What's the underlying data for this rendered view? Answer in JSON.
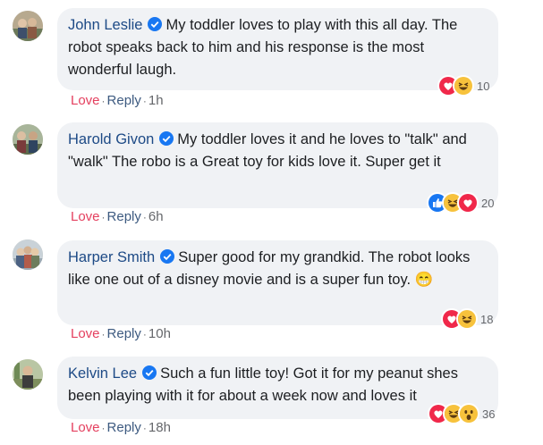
{
  "comments": [
    {
      "name": "John Leslie",
      "text": "My toddler loves to play with this all day. The robot speaks back to him and his response is the most wonderful laugh.",
      "reaction_count": "10",
      "love_label": "Love",
      "reply_label": "Reply",
      "time": "1h",
      "reactions": [
        "love-icon",
        "laugh-icon"
      ]
    },
    {
      "name": "Harold Givon",
      "text": "My toddler loves it and he loves to \"talk\" and \"walk\" The robo is a Great toy for kids love it. Super get it",
      "reaction_count": "20",
      "love_label": "Love",
      "reply_label": "Reply",
      "time": "6h",
      "reactions": [
        "like-icon",
        "laugh-icon",
        "love-icon"
      ]
    },
    {
      "name": "Harper Smith",
      "text": "Super good for my grandkid. The robot looks like one out of a disney movie and is a super fun toy. 😁",
      "reaction_count": "18",
      "love_label": "Love",
      "reply_label": "Reply",
      "time": "10h",
      "reactions": [
        "love-icon",
        "laugh-icon"
      ]
    },
    {
      "name": "Kelvin Lee",
      "text": "Such a fun little toy! Got it for my peanut shes been playing with it for about a week now and loves it",
      "reaction_count": "36",
      "love_label": "Love",
      "reply_label": "Reply",
      "time": "18h",
      "reactions": [
        "love-icon",
        "laugh-icon",
        "wow-icon"
      ]
    }
  ],
  "colors": {
    "name": "#1d4a86",
    "love": "#e4405f",
    "bubble": "#f0f2f5",
    "verified": "#1877f2",
    "meta": "#65676b"
  }
}
